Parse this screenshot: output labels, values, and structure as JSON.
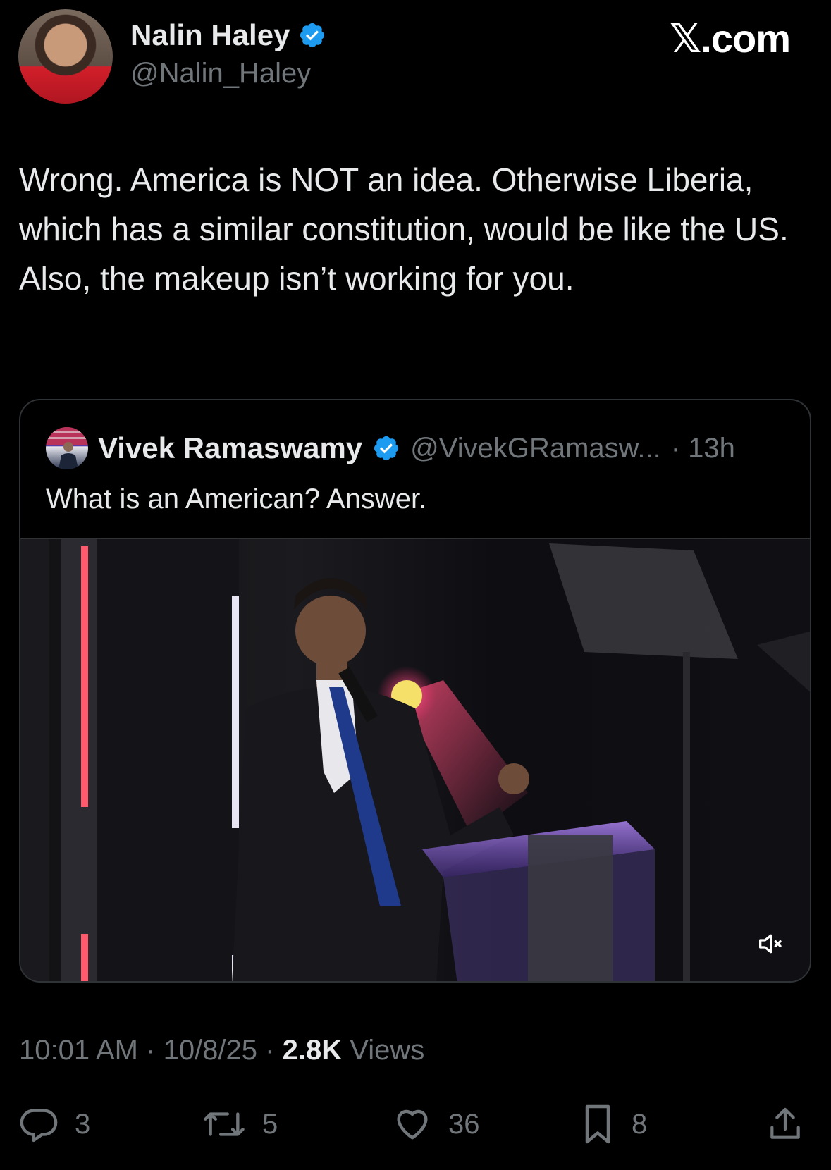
{
  "author": {
    "name": "Nalin Haley",
    "handle": "@Nalin_Haley",
    "verified": true
  },
  "site_mark": "𝕏.com",
  "tweet": {
    "text": "Wrong. America is NOT an idea. Otherwise Liberia, which has a similar constitution, would be like the US. Also, the makeup isn’t working for you."
  },
  "quoted": {
    "name": "Vivek Ramaswamy",
    "handle": "@VivekGRamasw...",
    "time": "· 13h",
    "text": "What is an American? Answer.",
    "media_muted": true
  },
  "meta": {
    "time": "10:01 AM",
    "date": "10/8/25",
    "views_count": "2.8K",
    "views_label": "Views"
  },
  "actions": {
    "replies": "3",
    "reposts": "5",
    "likes": "36",
    "bookmarks": "8"
  },
  "colors": {
    "background": "#000000",
    "text": "#e7e9ea",
    "muted_text": "#71767b",
    "verified_blue": "#1d9bf0",
    "border": "#2f3336"
  }
}
